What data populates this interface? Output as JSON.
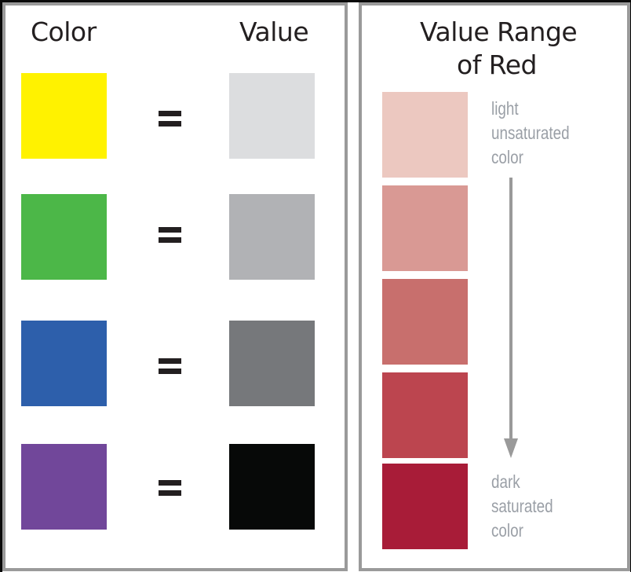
{
  "left_panel": {
    "color_heading": "Color",
    "value_heading": "Value",
    "rows": [
      {
        "color_name": "yellow",
        "color": "#fff200",
        "value_color": "#dcdddf",
        "equals": "="
      },
      {
        "color_name": "green",
        "color": "#4cb748",
        "value_color": "#b1b2b5",
        "equals": "="
      },
      {
        "color_name": "blue",
        "color": "#2d5fab",
        "value_color": "#76787b",
        "equals": "="
      },
      {
        "color_name": "purple",
        "color": "#71479a",
        "value_color": "#070908",
        "equals": "="
      }
    ]
  },
  "right_panel": {
    "heading_line1": "Value Range",
    "heading_line2": "of Red",
    "swatches": [
      {
        "color": "#ecc8c0"
      },
      {
        "color": "#d99994"
      },
      {
        "color": "#c86f6d"
      },
      {
        "color": "#bc454f"
      },
      {
        "color": "#a81c38"
      }
    ],
    "top_label": [
      "light",
      "unsaturated",
      "color"
    ],
    "bottom_label": [
      "dark",
      "saturated",
      "color"
    ],
    "arrow_color": "#9a9a9a",
    "arrow_icon": "arrow-down-icon"
  }
}
